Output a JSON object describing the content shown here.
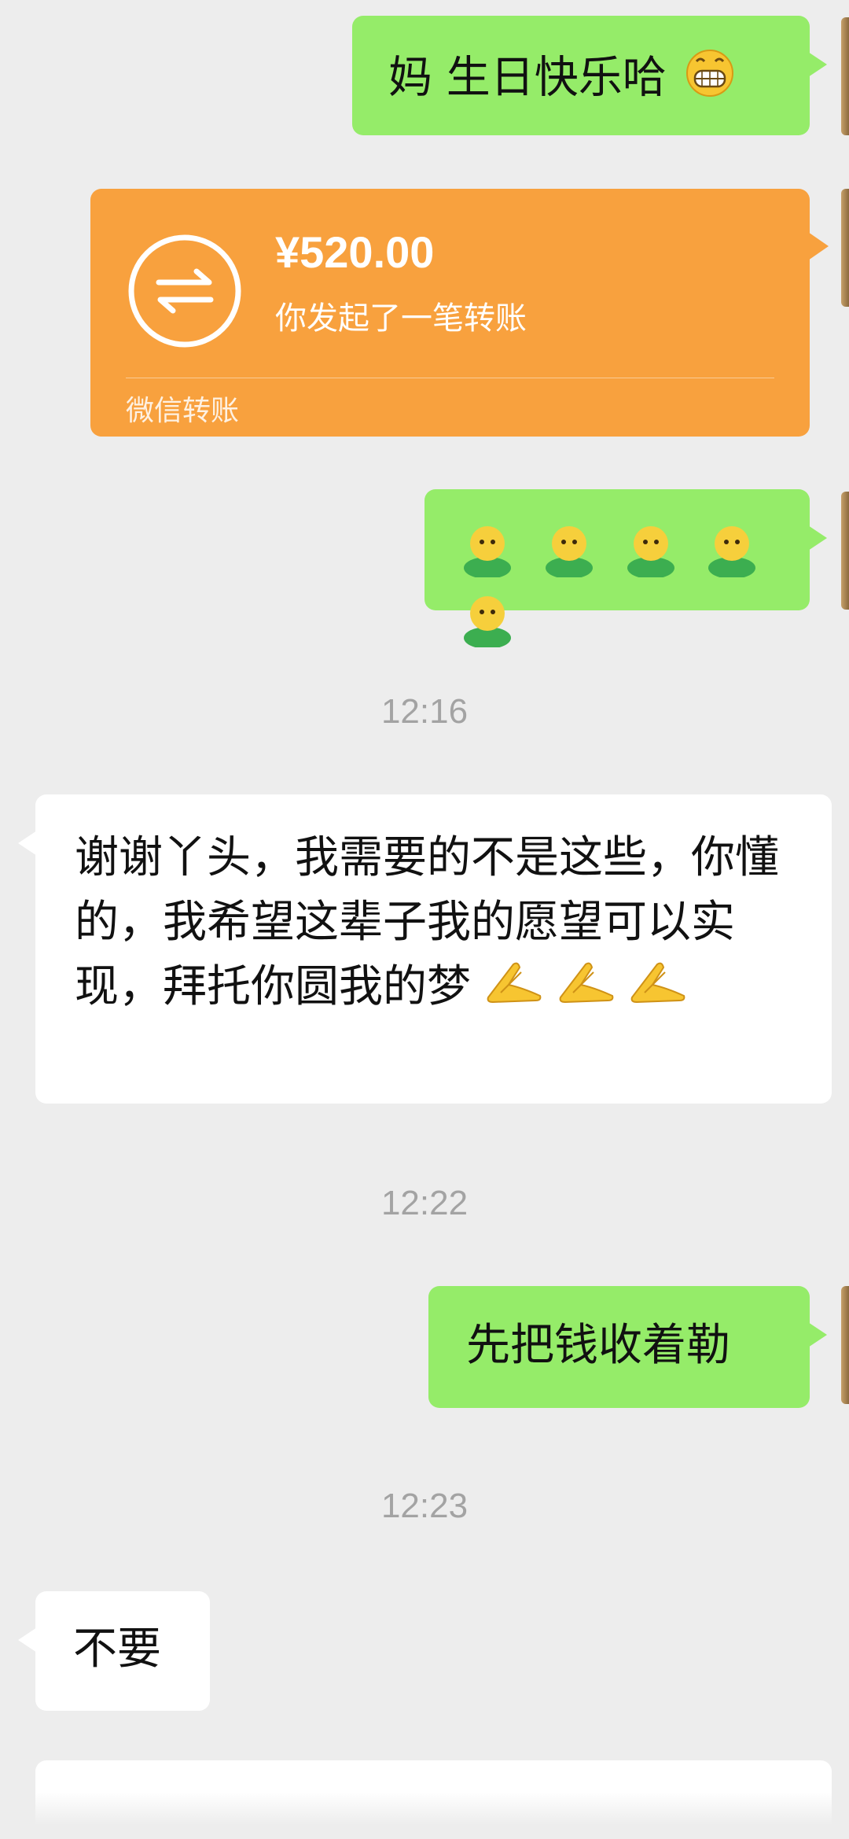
{
  "messages": {
    "m1": {
      "text": "妈 生日快乐哈",
      "emoji": "grinning-face"
    },
    "transfer": {
      "amount": "¥520.00",
      "description": "你发起了一笔转账",
      "footer": "微信转账",
      "color": "#f8a13e"
    },
    "m3": {
      "emoji": "green-sweater-figure",
      "count": 5
    },
    "ts1": "12:16",
    "m4": {
      "text": "谢谢丫头，我需要的不是这些，你懂的，我希望这辈子我的愿望可以实现，拜托你圆我的梦",
      "emoji": "pray-hands"
    },
    "ts2": "12:22",
    "m5": {
      "text": "先把钱收着勒"
    },
    "ts3": "12:23",
    "m6": {
      "text": "不要"
    }
  },
  "colors": {
    "chat_background": "#ededed",
    "outgoing_bubble": "#95ec69",
    "incoming_bubble": "#ffffff",
    "timestamp": "#a3a3a3"
  }
}
